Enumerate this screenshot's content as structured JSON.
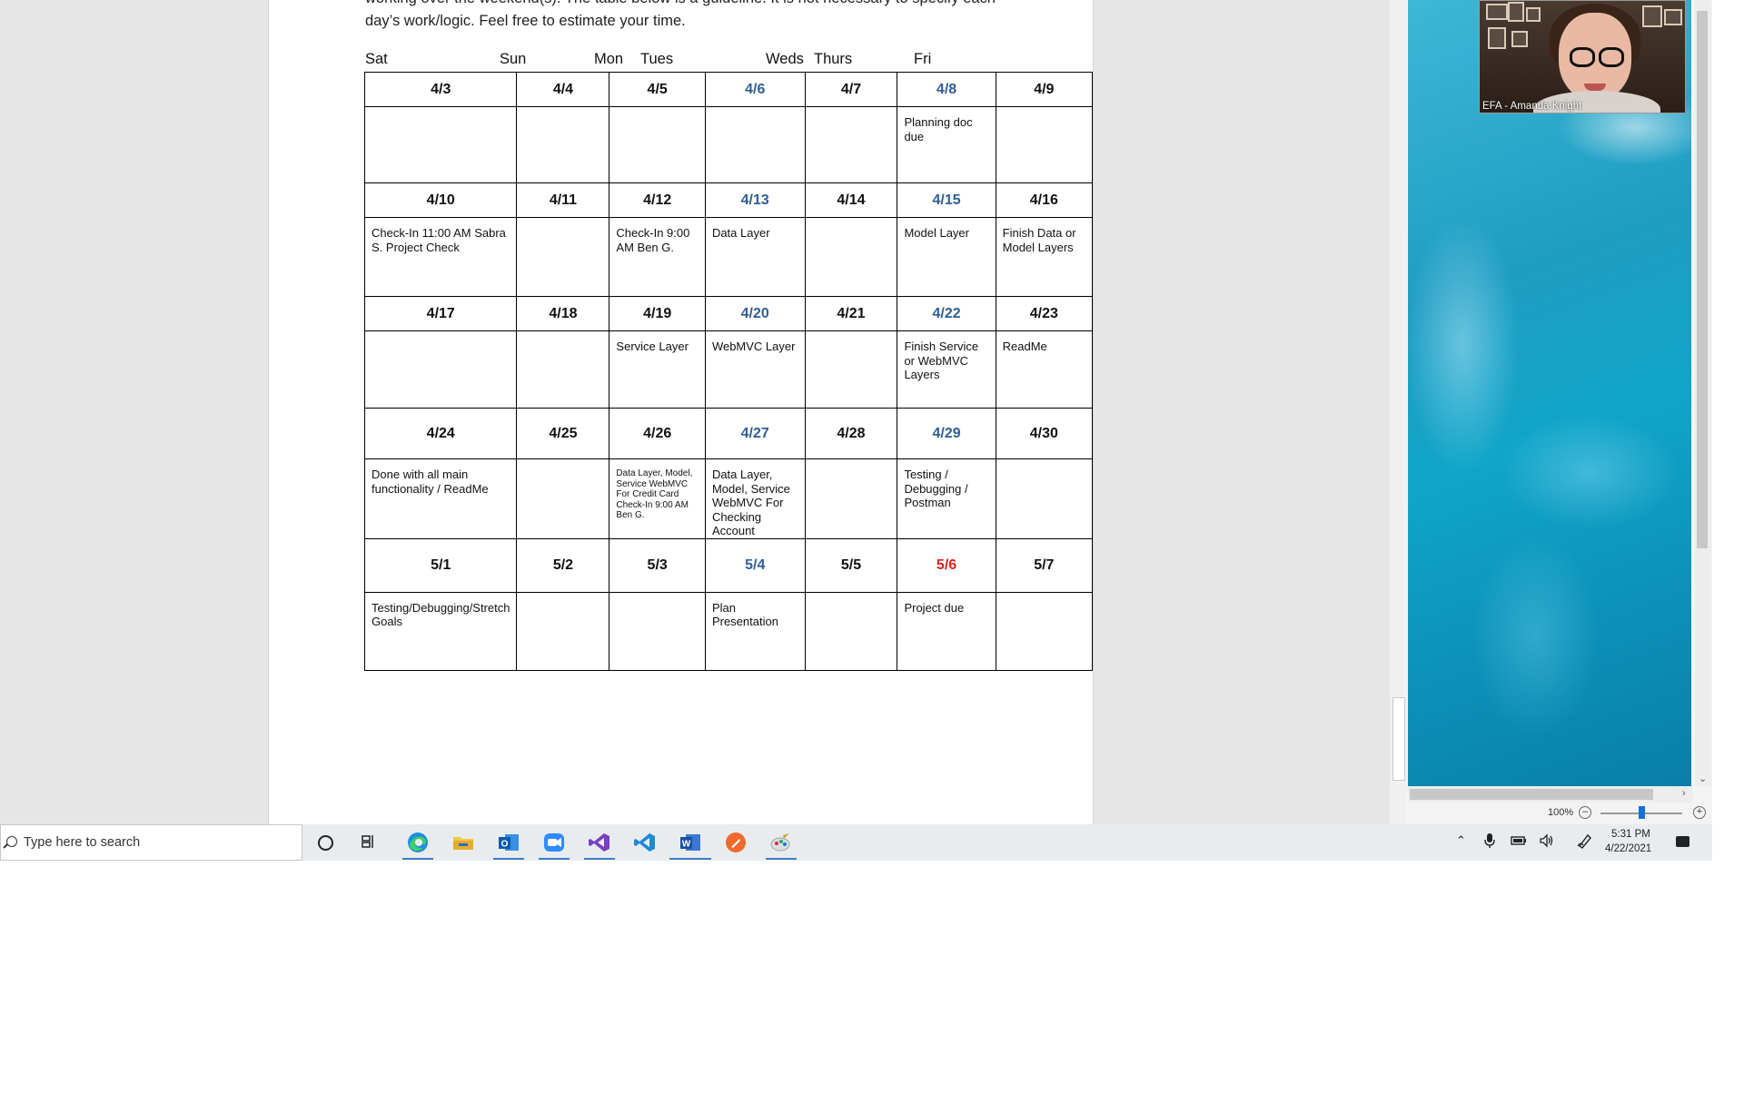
{
  "document": {
    "intro_line1": "working over the weekend(s). The table below is a guideline. It is not necessary to specify each",
    "intro_line2": "day’s work/logic. Feel free to estimate your time.",
    "day_headers": [
      "Sat",
      "Sun",
      "Mon",
      "Tues",
      "Weds",
      "Thurs",
      "Fri"
    ],
    "weeks": [
      {
        "dates": [
          "4/3",
          "4/4",
          "4/5",
          "4/6",
          "4/7",
          "4/8",
          "4/9"
        ],
        "notes": [
          "",
          "",
          "",
          "",
          "",
          "Planning doc due",
          ""
        ]
      },
      {
        "dates": [
          "4/10",
          "4/11",
          "4/12",
          "4/13",
          "4/14",
          "4/15",
          "4/16"
        ],
        "notes": [
          "Check-In 11:00 AM Sabra S. Project Check",
          "",
          "Check-In 9:00 AM Ben G.",
          "Data Layer",
          "",
          "Model Layer",
          "Finish Data or Model Layers"
        ]
      },
      {
        "dates": [
          "4/17",
          "4/18",
          "4/19",
          "4/20",
          "4/21",
          "4/22",
          "4/23"
        ],
        "notes": [
          "",
          "",
          "Service Layer",
          "WebMVC Layer",
          "",
          "Finish Service or WebMVC Layers",
          "ReadMe"
        ]
      },
      {
        "dates": [
          "4/24",
          "4/25",
          "4/26",
          "4/27",
          "4/28",
          "4/29",
          "4/30"
        ],
        "notes": [
          "Done with all main functionality / ReadMe",
          "",
          "Data Layer, Model, Service WebMVC For Credit Card Check-In 9:00 AM Ben G.",
          "Data Layer, Model, Service WebMVC For Checking Account",
          "",
          "Testing / Debugging / Postman",
          ""
        ]
      },
      {
        "dates": [
          "5/1",
          "5/2",
          "5/3",
          "5/4",
          "5/5",
          "5/6",
          "5/7"
        ],
        "notes": [
          "Testing/Debugging/Stretch Goals",
          "",
          "",
          "Plan Presentation",
          "",
          "Project due",
          ""
        ]
      }
    ],
    "colors": {
      "thursday_blue": "#2e5e96",
      "due_red": "#e02020"
    }
  },
  "zoom": {
    "participant_name": "EFA - Amanda Knight"
  },
  "statusbar": {
    "zoom_level": "100%"
  },
  "taskbar": {
    "search_placeholder": "Type here to search",
    "apps": [
      "cortana-icon",
      "task-view-icon",
      "edge-icon",
      "file-explorer-icon",
      "outlook-icon",
      "zoom-icon",
      "visual-studio-icon",
      "vscode-icon",
      "word-icon",
      "postman-icon",
      "paint-icon"
    ],
    "time": "5:31 PM",
    "date": "4/22/2021"
  }
}
